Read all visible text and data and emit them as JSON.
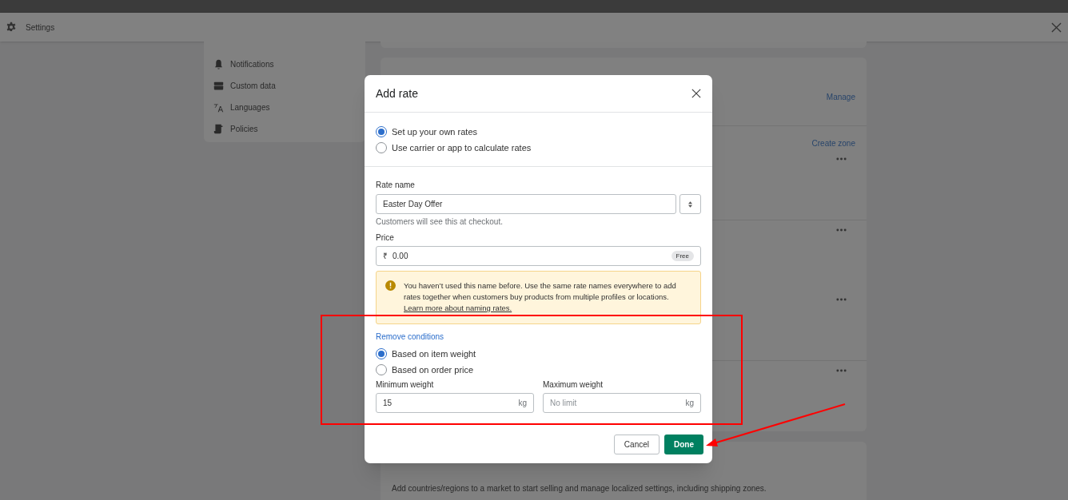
{
  "header": {
    "title": "Settings"
  },
  "sidebar": {
    "items": [
      {
        "label": "Notifications"
      },
      {
        "label": "Custom data"
      },
      {
        "label": "Languages"
      },
      {
        "label": "Policies"
      }
    ]
  },
  "shipping_card": {
    "manage_link": "Manage",
    "create_zone_link": "Create zone"
  },
  "markets_card": {
    "description": "Add countries/regions to a market to start selling and manage localized settings, including shipping zones."
  },
  "modal": {
    "title": "Add rate",
    "rate_type": [
      {
        "label": "Set up your own rates",
        "selected": true
      },
      {
        "label": "Use carrier or app to calculate rates",
        "selected": false
      }
    ],
    "rate_name": {
      "label": "Rate name",
      "value": "Easter Day Offer",
      "help": "Customers will see this at checkout."
    },
    "price": {
      "label": "Price",
      "currency": "₹",
      "value": "0.00",
      "badge": "Free"
    },
    "warning": {
      "text": "You haven’t used this name before. Use the same rate names everywhere to add rates together when customers buy products from multiple profiles or locations.",
      "link": "Learn more about naming rates."
    },
    "conditions_link": "Remove conditions",
    "condition_type": [
      {
        "label": "Based on item weight",
        "selected": true
      },
      {
        "label": "Based on order price",
        "selected": false
      }
    ],
    "min_weight": {
      "label": "Minimum weight",
      "value": "15",
      "unit": "kg"
    },
    "max_weight": {
      "label": "Maximum weight",
      "placeholder": "No limit",
      "unit": "kg"
    },
    "buttons": {
      "cancel": "Cancel",
      "done": "Done"
    }
  }
}
